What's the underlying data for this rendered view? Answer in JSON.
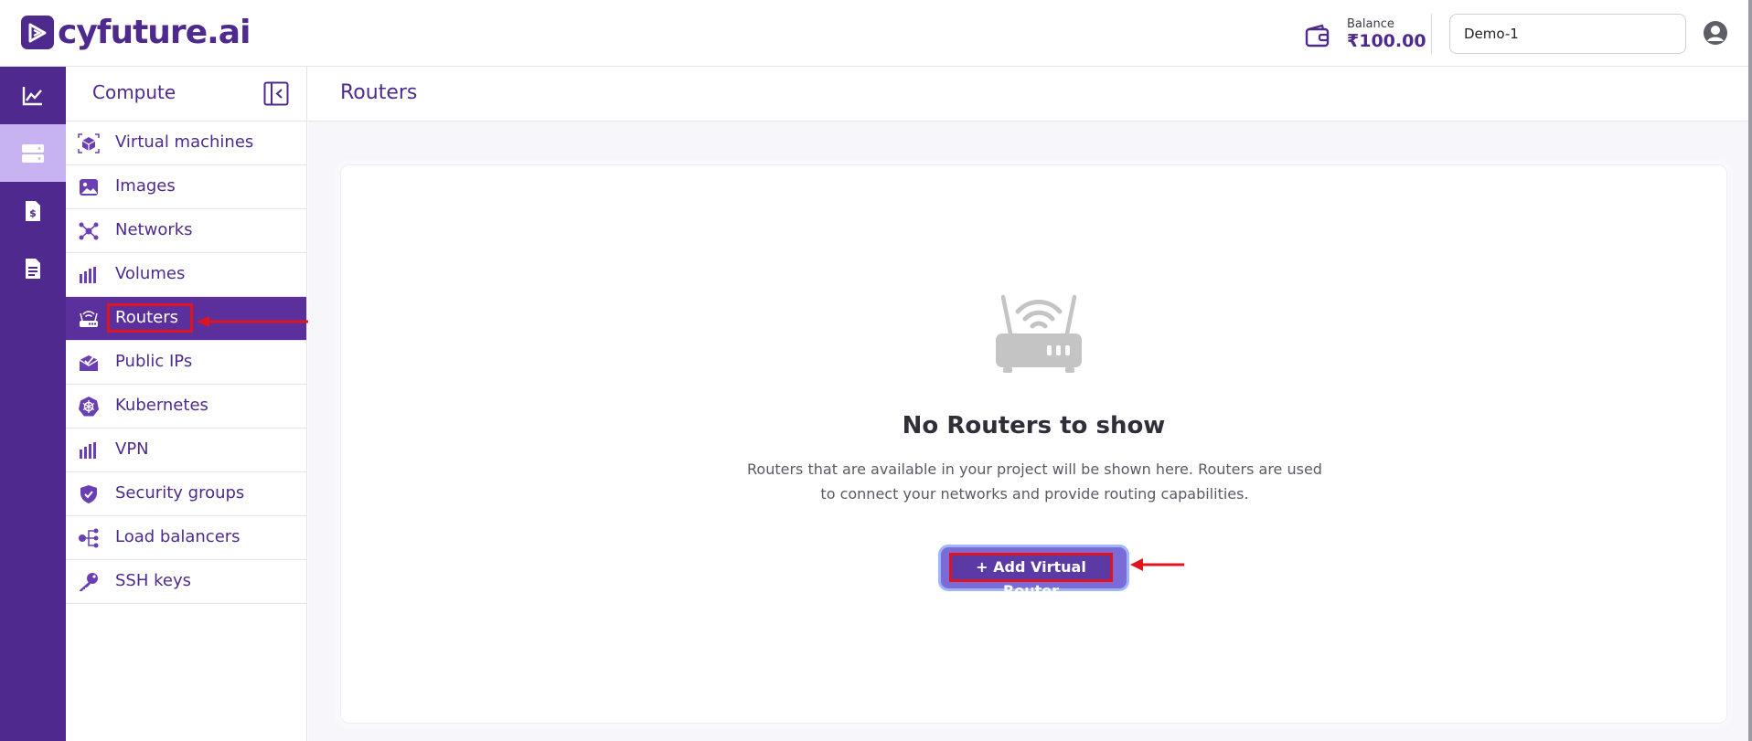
{
  "brand": {
    "name": "cyfuture.ai"
  },
  "header": {
    "balance_label": "Balance",
    "balance_value": "₹100.00",
    "project": "Demo-1"
  },
  "rail": {
    "items": [
      "analytics-icon",
      "compute-server-icon",
      "billing-invoice-icon",
      "document-icon"
    ],
    "active": 1
  },
  "sidebar": {
    "title": "Compute",
    "items": [
      {
        "label": "Virtual machines",
        "icon": "cube-icon"
      },
      {
        "label": "Images",
        "icon": "image-icon"
      },
      {
        "label": "Networks",
        "icon": "network-icon"
      },
      {
        "label": "Volumes",
        "icon": "volumes-icon"
      },
      {
        "label": "Routers",
        "icon": "router-icon"
      },
      {
        "label": "Public IPs",
        "icon": "public-ip-icon"
      },
      {
        "label": "Kubernetes",
        "icon": "kubernetes-icon"
      },
      {
        "label": "VPN",
        "icon": "vpn-icon"
      },
      {
        "label": "Security groups",
        "icon": "shield-icon"
      },
      {
        "label": "Load balancers",
        "icon": "load-balancer-icon"
      },
      {
        "label": "SSH keys",
        "icon": "key-icon"
      }
    ],
    "active": 4
  },
  "main": {
    "title": "Routers",
    "empty_title": "No Routers to show",
    "empty_desc": "Routers that are available in your project will be shown here. Routers are used to connect your networks and provide routing capabilities.",
    "add_button": "+ Add Virtual Router"
  },
  "colors": {
    "brand_purple": "#50298f",
    "active_nav": "#5b2f9c",
    "rail_active": "#c7b3f2",
    "highlight_red": "#e0141e"
  }
}
